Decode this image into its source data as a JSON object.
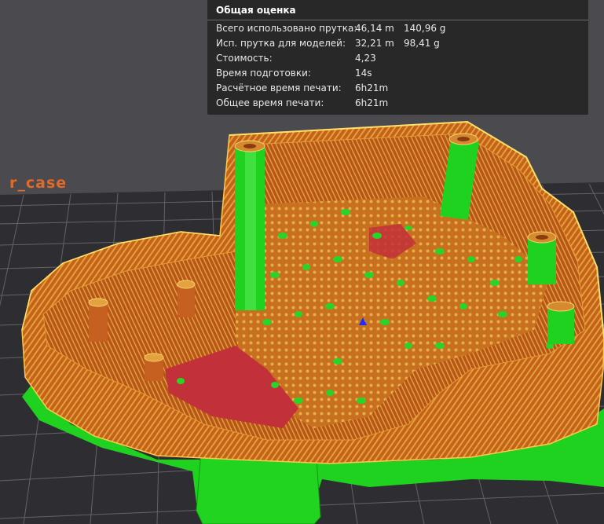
{
  "object_name": "r_case",
  "summary": {
    "title": "Общая оценка",
    "rows": [
      {
        "label": "Всего использовано прутка:",
        "value": "46,14 m",
        "value2": "140,96 g"
      },
      {
        "label": "Исп. прутка для моделей:",
        "value": "32,21 m",
        "value2": "98,41 g"
      },
      {
        "label": "Стоимость:",
        "value": "4,23",
        "value2": ""
      },
      {
        "label": "Время подготовки:",
        "value": "14s",
        "value2": ""
      },
      {
        "label": "Расчётное время печати:",
        "value": "6h21m",
        "value2": ""
      },
      {
        "label": "Общее время печати:",
        "value": "6h21m",
        "value2": ""
      }
    ]
  },
  "colors": {
    "background": "#4a4a4f",
    "plate": "#2f2f33",
    "grid": "#6a6a70",
    "wall": "#c8651d",
    "support": "#22d622",
    "infill": "#c02d35",
    "top": "#e09a3a"
  }
}
